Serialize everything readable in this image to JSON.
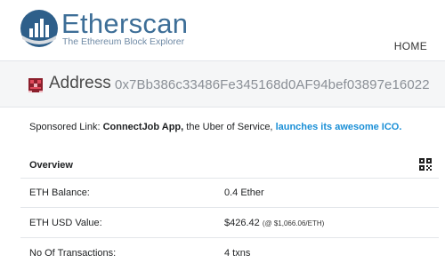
{
  "header": {
    "brand": "Etherscan",
    "tagline": "The Ethereum Block Explorer",
    "nav_home": "HOME"
  },
  "address": {
    "title": "Address",
    "hash": "0x7Bb386c33486Fe345168d0AF94bef03897e16022"
  },
  "sponsored": {
    "prefix": "Sponsored Link:",
    "name": "ConnectJob App,",
    "middle": "the Uber of Service,",
    "link": "launches its awesome ICO."
  },
  "overview": {
    "title": "Overview",
    "rows": [
      {
        "label": "ETH Balance:",
        "value": "0.4 Ether",
        "note": ""
      },
      {
        "label": "ETH USD Value:",
        "value": "$426.42",
        "note": "(@ $1,066.06/ETH)"
      },
      {
        "label": "No Of Transactions:",
        "value": "4 txns",
        "note": ""
      }
    ]
  },
  "icons": {
    "logo": "etherscan-logo-icon",
    "identicon": "address-identicon-icon",
    "qr": "qr-code-icon"
  },
  "colors": {
    "brand": "#3d6e97",
    "link": "#1a8fd6",
    "address_bg": "#f5f6f7"
  }
}
